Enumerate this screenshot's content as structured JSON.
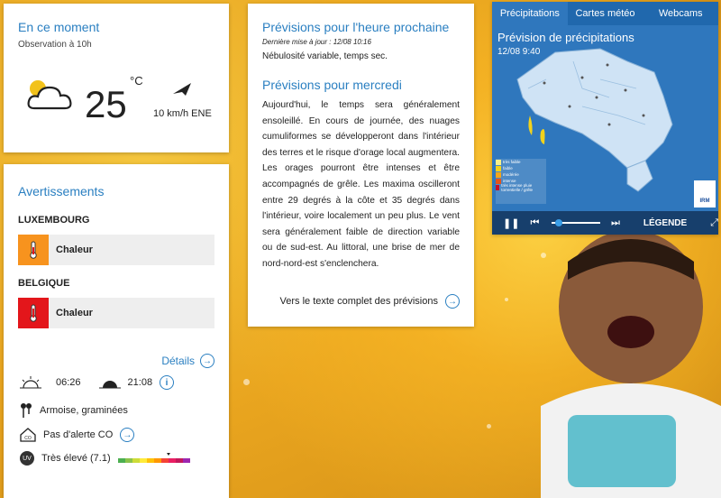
{
  "now": {
    "title": "En ce moment",
    "observation": "Observation à 10h",
    "temperature": "25",
    "unit": "°C",
    "wind": "10 km/h ENE",
    "weather_icon": "partly-cloudy-icon"
  },
  "warnings": {
    "title": "Avertissements",
    "regions": [
      {
        "name": "LUXEMBOURG",
        "label": "Chaleur",
        "color": "#f7931e"
      },
      {
        "name": "BELGIQUE",
        "label": "Chaleur",
        "color": "#e3161b"
      }
    ],
    "details": "Détails",
    "sunrise": "06:26",
    "sunset": "21:08",
    "pollen": "Armoise, graminées",
    "co": "Pas d'alerte CO",
    "uv_badge": "UV",
    "uv": "Très élevé (7.1)"
  },
  "forecast": {
    "title1": "Prévisions pour l'heure prochaine",
    "updated": "Dernière mise à jour : 12/08 10:16",
    "short": "Nébulosité variable, temps sec.",
    "title2": "Prévisions pour mercredi",
    "text": "Aujourd'hui, le temps sera généralement ensoleillé. En cours de journée, des nuages cumuliformes se développeront dans l'intérieur des terres et le risque d'orage local augmentera. Les orages pourront être intenses et être accompagnés de grêle. Les maxima oscilleront entre 29 degrés à la côte et 35 degrés dans l'intérieur, voire localement un peu plus. Le vent sera généralement faible de direction variable ou de sud-est. Au littoral, une brise de mer de nord-nord-est s'enclenchera.",
    "full_link": "Vers le texte complet des prévisions"
  },
  "map": {
    "tabs": [
      "Précipitations",
      "Cartes météo",
      "Webcams"
    ],
    "title": "Prévision de précipitations",
    "time": "12/08 9:40",
    "legend_items": [
      {
        "label": "très faible",
        "color": "#f7f08a"
      },
      {
        "label": "faible",
        "color": "#f2d21c"
      },
      {
        "label": "modérée",
        "color": "#f2a51c"
      },
      {
        "label": "intense",
        "color": "#e3531b"
      },
      {
        "label": "très intense pluie torrentielle / grêle",
        "color": "#c4102a"
      }
    ],
    "logo": "IRM",
    "legend_button": "LÉGENDE"
  }
}
